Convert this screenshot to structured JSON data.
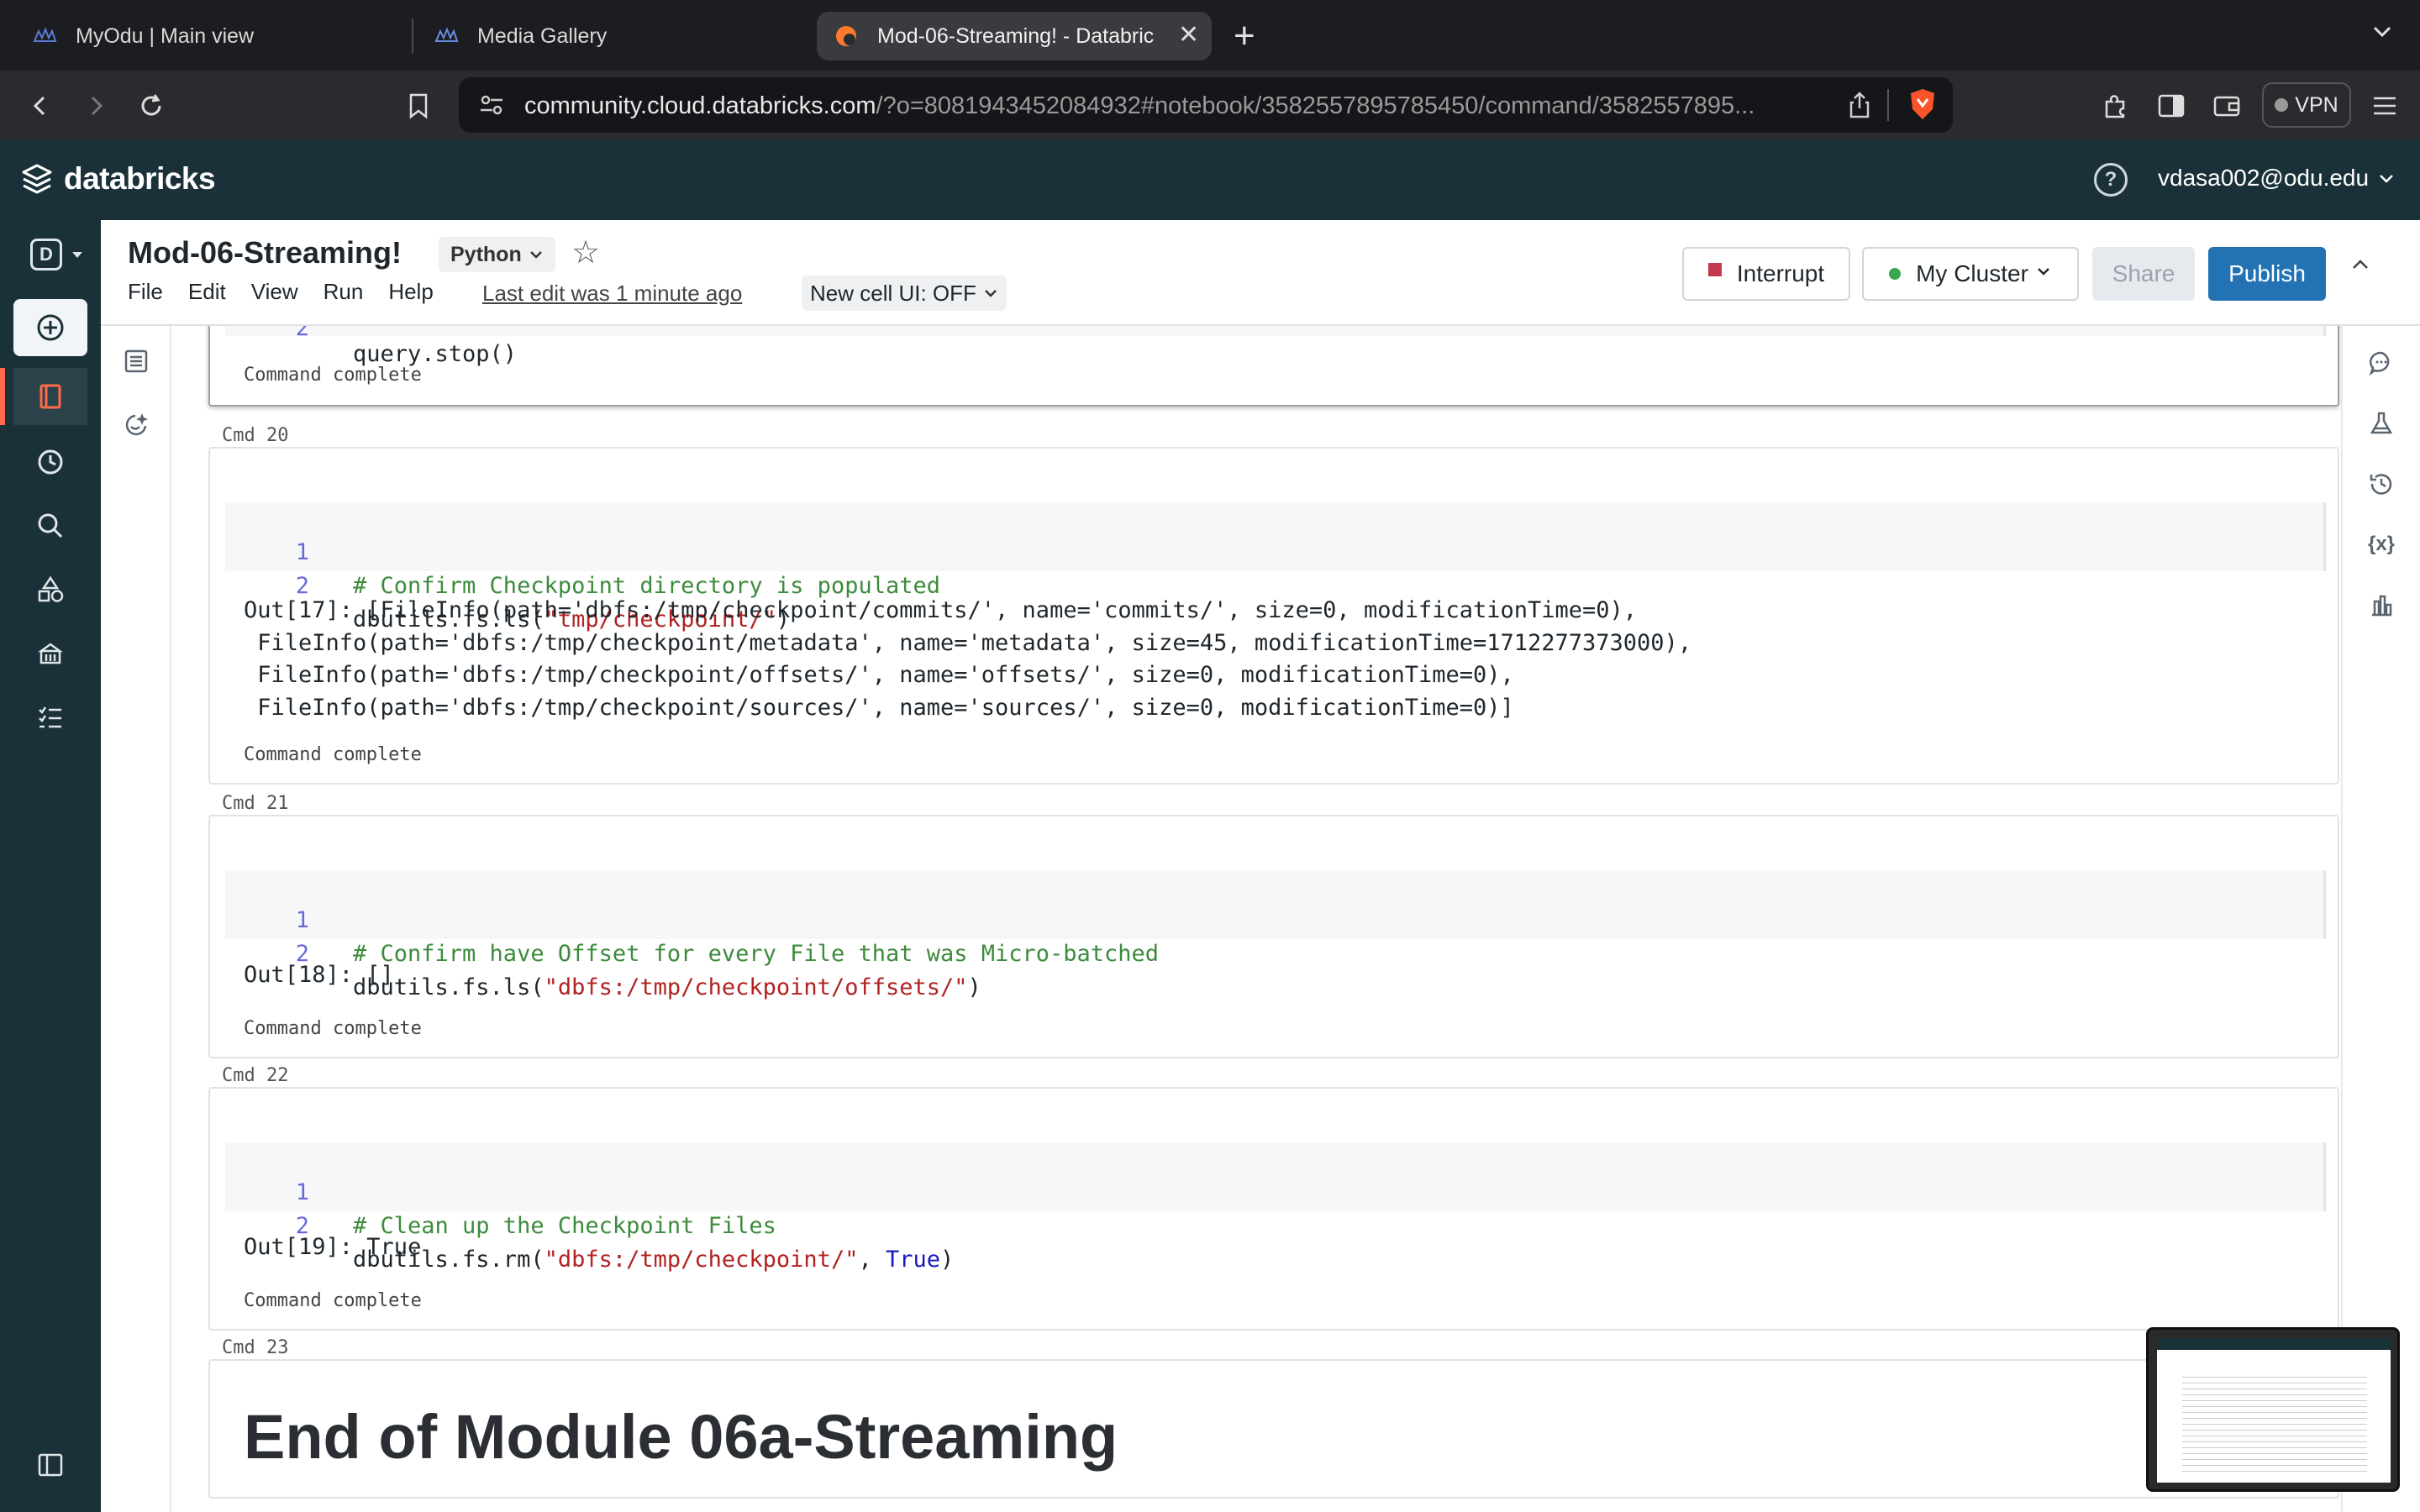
{
  "browser": {
    "tabs": [
      {
        "title": "MyOdu | Main view",
        "icon": "odu-icon"
      },
      {
        "title": "Media Gallery",
        "icon": "gallery-icon"
      },
      {
        "title": "Mod-06-Streaming! - Databric",
        "icon": "databricks-icon",
        "active": true
      }
    ],
    "url_host": "community.cloud.databricks.com",
    "url_rest": "/?o=8081943452084932#notebook/3582557895785450/command/3582557895...",
    "vpn_label": "VPN"
  },
  "app": {
    "logo_text": "databricks",
    "user": "vdasa002@odu.edu",
    "workspace_letter": "D"
  },
  "notebook": {
    "title": "Mod-06-Streaming!",
    "language": "Python",
    "menu": [
      "File",
      "Edit",
      "View",
      "Run",
      "Help"
    ],
    "last_edit": "Last edit was 1 minute ago",
    "new_cell_ui": "New cell UI: OFF",
    "interrupt_label": "Interrupt",
    "cluster_label": "My Cluster",
    "share_label": "Share",
    "publish_label": "Publish"
  },
  "cells": {
    "prev": {
      "line_no": "2",
      "code": "query.stop()",
      "status": "Command complete"
    },
    "c20": {
      "label": "Cmd 20",
      "line1_no": "1",
      "line1": "# Confirm Checkpoint directory is populated",
      "line2_no": "2",
      "line2_fn": "dbutils.fs.ls(",
      "line2_str": "\"tmp/checkpoint/\"",
      "line2_end": ")",
      "output": [
        "Out[17]: [FileInfo(path='dbfs:/tmp/checkpoint/commits/', name='commits/', size=0, modificationTime=0),",
        " FileInfo(path='dbfs:/tmp/checkpoint/metadata', name='metadata', size=45, modificationTime=1712277373000),",
        " FileInfo(path='dbfs:/tmp/checkpoint/offsets/', name='offsets/', size=0, modificationTime=0),",
        " FileInfo(path='dbfs:/tmp/checkpoint/sources/', name='sources/', size=0, modificationTime=0)]"
      ],
      "status": "Command complete"
    },
    "c21": {
      "label": "Cmd 21",
      "line1_no": "1",
      "line1": "# Confirm have Offset for every File that was Micro-batched",
      "line2_no": "2",
      "line2_fn": "dbutils.fs.ls(",
      "line2_str": "\"dbfs:/tmp/checkpoint/offsets/\"",
      "line2_end": ")",
      "output": "Out[18]: []",
      "status": "Command complete"
    },
    "c22": {
      "label": "Cmd 22",
      "line1_no": "1",
      "line1": "# Clean up the Checkpoint Files",
      "line2_no": "2",
      "line2_fn": "dbutils.fs.rm(",
      "line2_str": "\"dbfs:/tmp/checkpoint/\"",
      "line2_sep": ", ",
      "line2_kw": "True",
      "line2_end": ")",
      "output": "Out[19]: True",
      "status": "Command complete"
    },
    "c23": {
      "label": "Cmd 23",
      "heading": "End of Module 06a-Streaming"
    }
  }
}
